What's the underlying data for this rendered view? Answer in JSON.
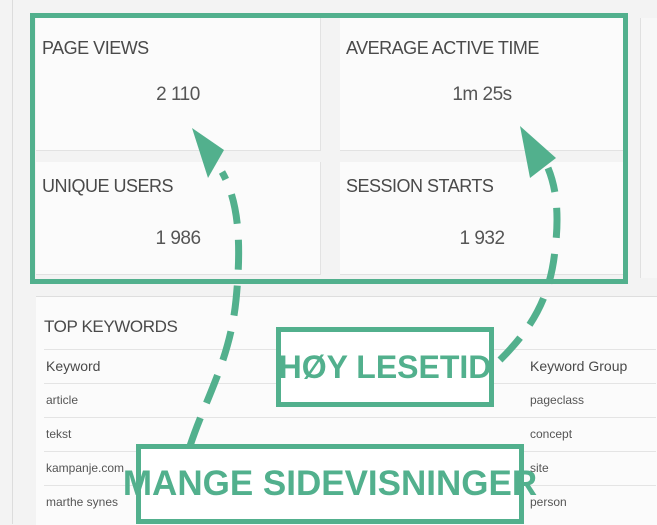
{
  "metrics": {
    "page_views": {
      "label": "PAGE VIEWS",
      "value": "2 110"
    },
    "average_active_time": {
      "label": "AVERAGE ACTIVE TIME",
      "value": "1m 25s"
    },
    "unique_users": {
      "label": "UNIQUE USERS",
      "value": "1 986"
    },
    "session_starts": {
      "label": "SESSION STARTS",
      "value": "1 932"
    }
  },
  "keywords": {
    "title": "TOP KEYWORDS",
    "columns": [
      "Keyword",
      "Keyword Group"
    ],
    "rows": [
      [
        "article",
        "pageclass"
      ],
      [
        "tekst",
        "concept"
      ],
      [
        "kampanje.com",
        "site"
      ],
      [
        "marthe synes",
        "person"
      ]
    ]
  },
  "annotations": {
    "reading_time": "HØY LESETID",
    "many_pageviews": "MANGE SIDEVISNINGER",
    "accent_color": "#52b08d"
  }
}
